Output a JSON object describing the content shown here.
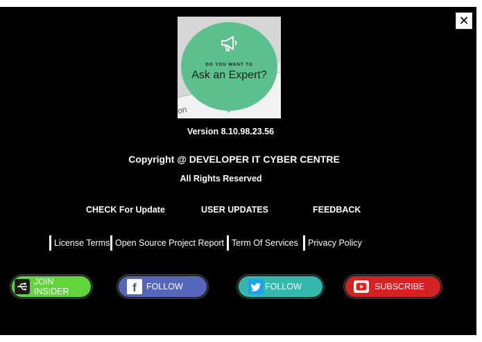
{
  "close": {
    "glyph": "✕"
  },
  "promo": {
    "small_text": "DO YOU WANT TO",
    "big_text": "Ask an Expert?",
    "corner_text": "on"
  },
  "about": {
    "version": "Version 8.10.98.23.56",
    "copyright": "Copyright @ DEVELOPER IT CYBER CENTRE",
    "rights": "All Rights Reserved"
  },
  "actions": {
    "check_update": "CHECK For Update",
    "user_updates": "USER UPDATES",
    "feedback": "FEEDBACK"
  },
  "legal_links": [
    {
      "label": "License Terms"
    },
    {
      "label": "Open Source Project Report"
    },
    {
      "label": "Term Of Services"
    },
    {
      "label": "Privacy Policy"
    }
  ],
  "social": [
    {
      "label": "JOIN INSIDER",
      "icon": "usb-icon",
      "color": "#5fd53b"
    },
    {
      "label": "FOLLOW",
      "icon": "facebook-icon",
      "color": "#5566bb"
    },
    {
      "label": "FOLLOW",
      "icon": "twitter-icon",
      "color": "#34b8ae"
    },
    {
      "label": "SUBSCRIBE",
      "icon": "youtube-icon",
      "color": "#d42222"
    }
  ],
  "colors": {
    "background": "#000000",
    "text": "#ffffff",
    "promo_bubble": "#5cc08e"
  }
}
